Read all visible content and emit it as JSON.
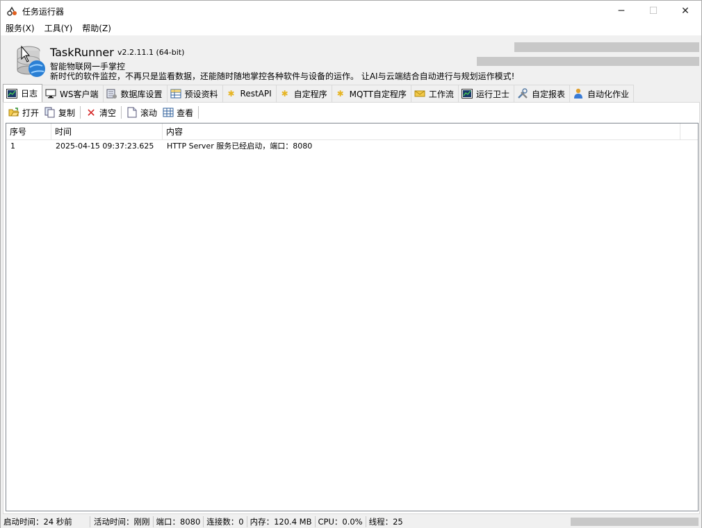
{
  "window": {
    "title": "任务运行器"
  },
  "menu": [
    "服务(X)",
    "工具(Y)",
    "帮助(Z)"
  ],
  "header": {
    "app_name": "TaskRunner",
    "version": "v2.2.11.1 (64-bit)",
    "slogan1": "智能物联网一手掌控",
    "slogan2": "新时代的软件监控，不再只是监看数据，还能随时随地掌控各种软件与设备的运作。 让AI与云端结合自动进行与规划运作模式!"
  },
  "tabs": [
    {
      "label": "日志",
      "icon": "log-chart-icon",
      "active": true
    },
    {
      "label": "WS客户端",
      "icon": "monitor-icon"
    },
    {
      "label": "数据库设置",
      "icon": "database-settings-icon"
    },
    {
      "label": "预设资料",
      "icon": "table-icon"
    },
    {
      "label": "RestAPI",
      "icon": "puzzle-icon"
    },
    {
      "label": "自定程序",
      "icon": "puzzle-icon"
    },
    {
      "label": "MQTT自定程序",
      "icon": "puzzle-icon"
    },
    {
      "label": "工作流",
      "icon": "workflow-icon"
    },
    {
      "label": "运行卫士",
      "icon": "chart-icon"
    },
    {
      "label": "自定报表",
      "icon": "tools-icon"
    },
    {
      "label": "自动化作业",
      "icon": "user-icon"
    }
  ],
  "toolbar": {
    "open": "打开",
    "copy": "复制",
    "clear": "清空",
    "scroll": "滚动",
    "view": "查看"
  },
  "grid": {
    "columns": [
      "序号",
      "时间",
      "内容"
    ],
    "rows": [
      {
        "no": "1",
        "time": "2025-04-15 09:37:23.625",
        "content": "HTTP Server 服务已经启动，端口：8080"
      }
    ]
  },
  "status": {
    "uptime": "启动时间：24 秒前",
    "active": "活动时间：刚刚",
    "port": "端口：8080",
    "connections": "连接数：0",
    "memory": "内存：120.4 MB",
    "cpu": "CPU：0.0%",
    "threads": "线程：25"
  },
  "colors": {
    "accent": "#0078d7",
    "blur": "#c8c8c8"
  }
}
